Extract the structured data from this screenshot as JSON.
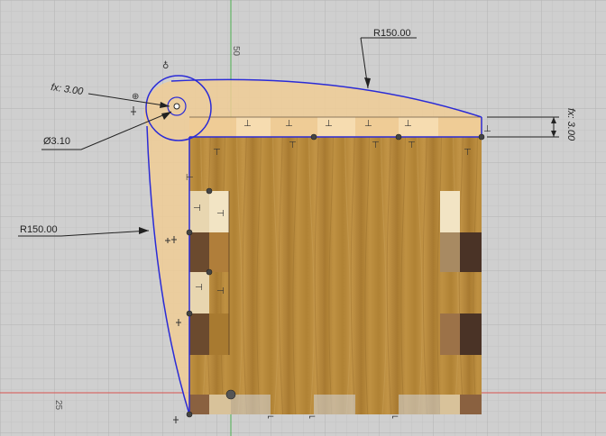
{
  "viewport": {
    "background": "#cfcfcf",
    "grid_minor": "#c2c2c2",
    "grid_major": "#b2b2b2"
  },
  "axes": {
    "green_axis": "#4caf50",
    "red_axis": "#d9534f"
  },
  "sketch": {
    "profile_color": "#2b2bd6",
    "fill_color": "#f0cc95"
  },
  "grid_labels": {
    "top": "50",
    "middle": "25",
    "left": "25"
  },
  "dimensions": {
    "top_radius": "R150.00",
    "left_radius": "R150.00",
    "fillet": "fx: 3.00",
    "diameter": "Ø3.10",
    "offset": "fx: 3.00"
  },
  "wood": {
    "main": "#b88a3a",
    "dark": "#6b4a2e",
    "light": "#e8d6b0",
    "mid": "#9c7248"
  },
  "constraint_glyph": "≡",
  "lock_icon_name": "lock-icon",
  "coincident_icon_name": "coincident-point-icon"
}
